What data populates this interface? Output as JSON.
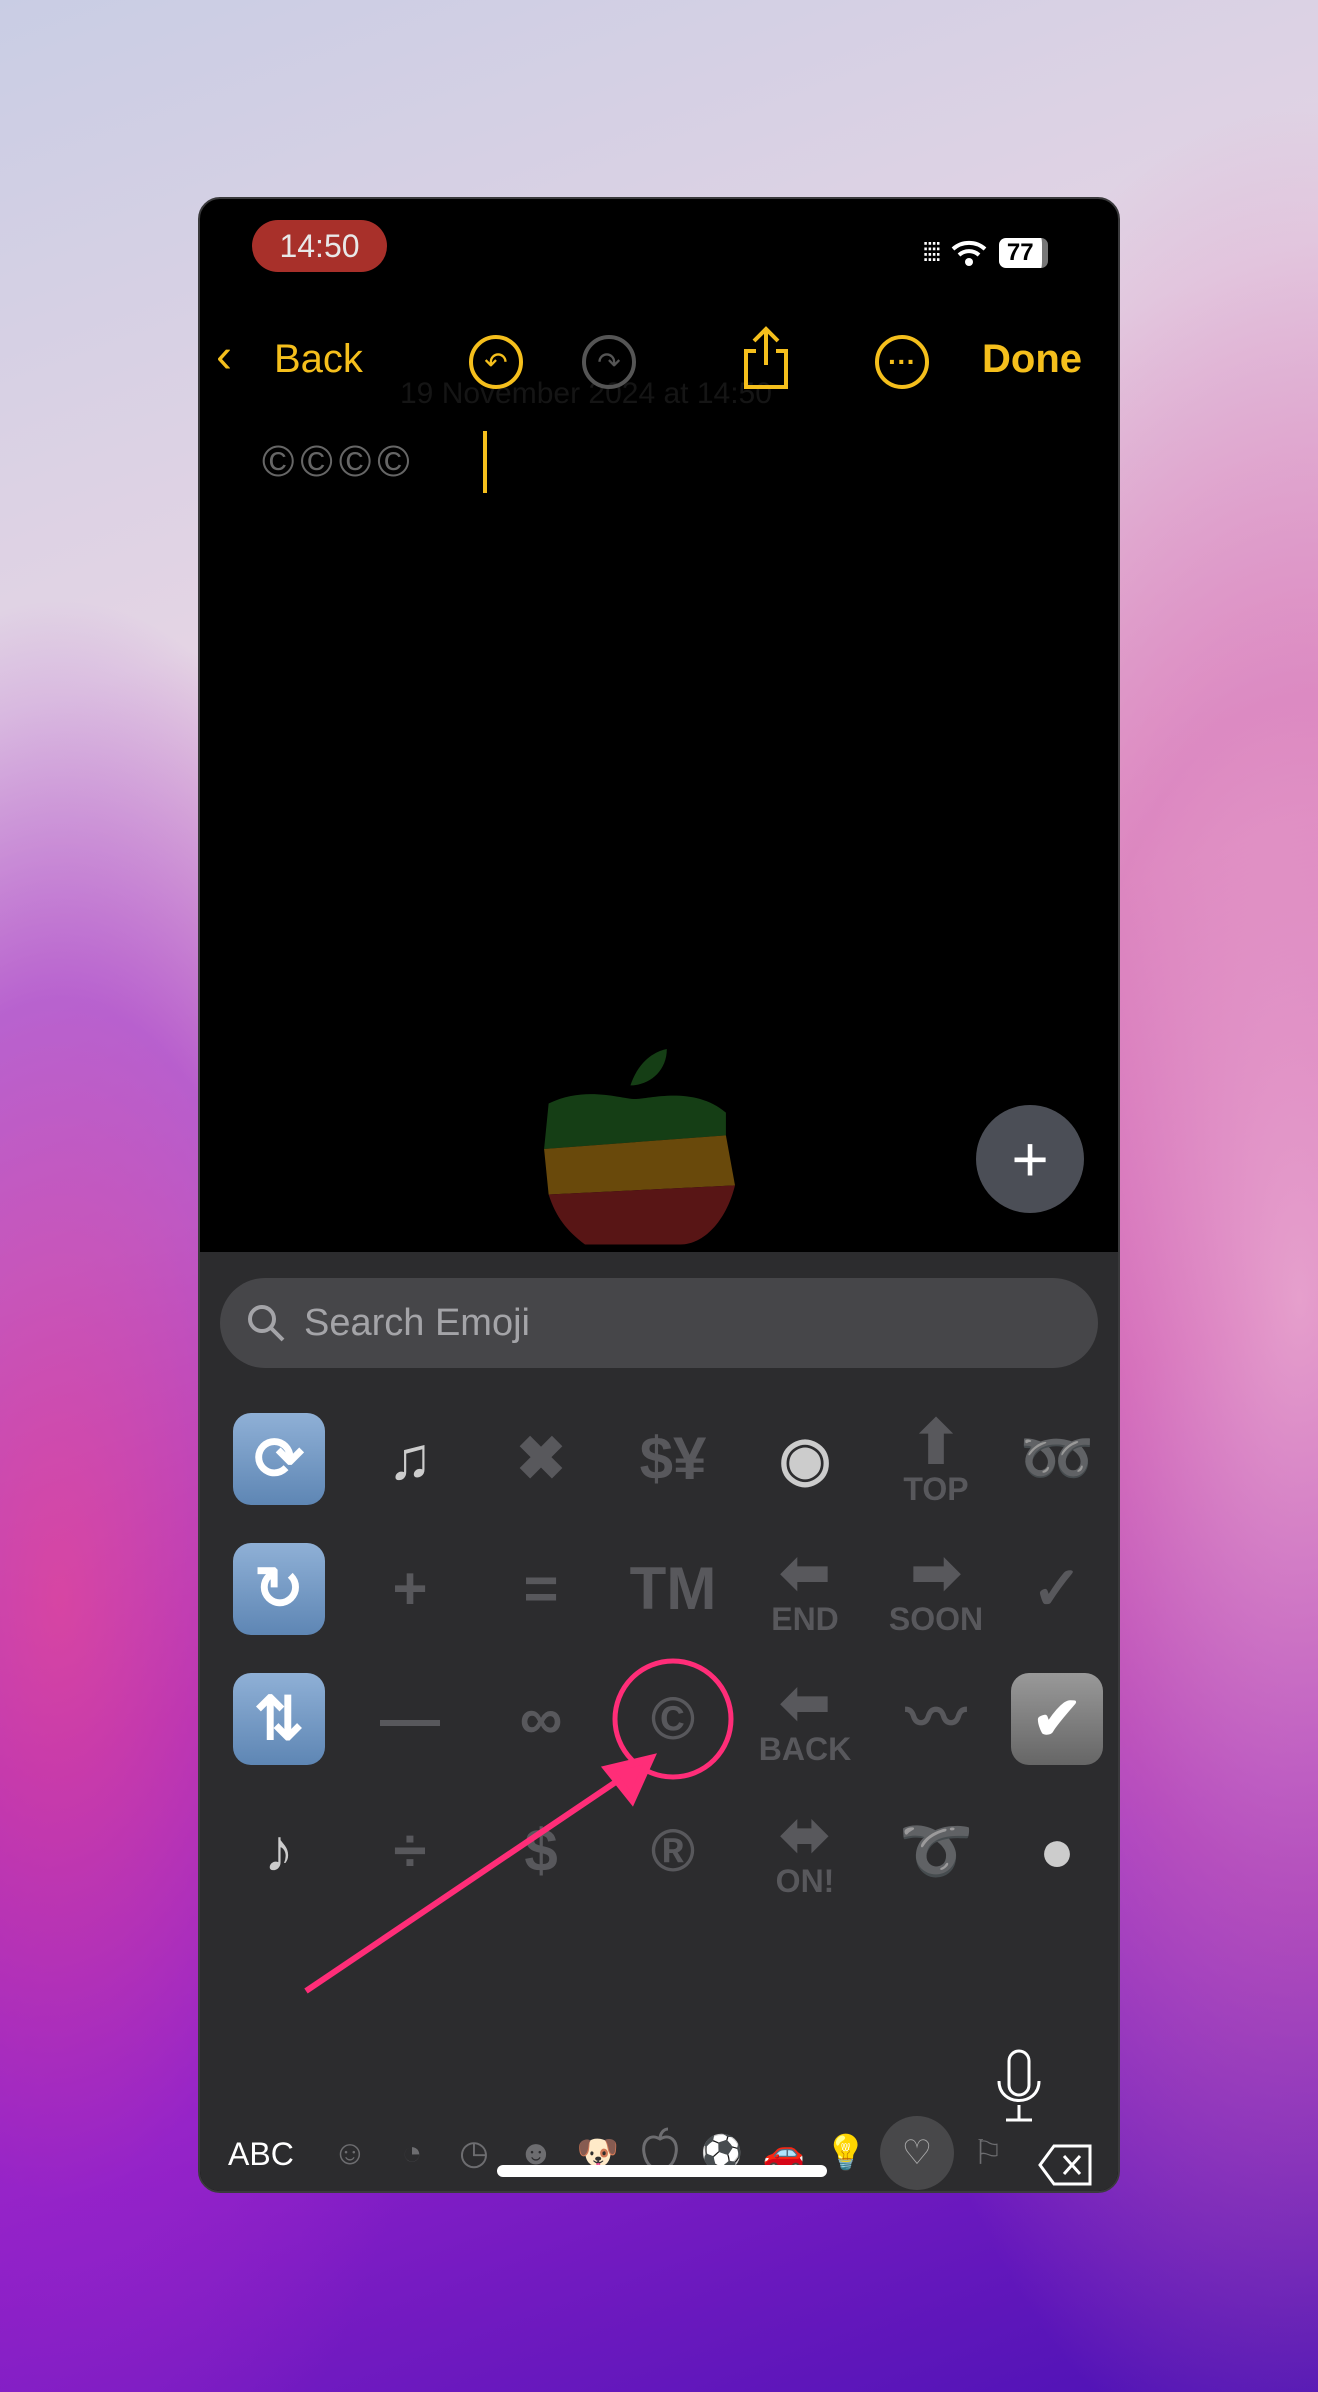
{
  "status": {
    "time": "14:50",
    "battery": "77",
    "time_pill_color": "#a8302a"
  },
  "nav": {
    "back": "Back",
    "done": "Done",
    "accent": "#f5bf1c",
    "icons": [
      "chevron-left",
      "undo",
      "redo",
      "share",
      "more"
    ]
  },
  "note": {
    "date": "19 November 2024 at 14:50",
    "content": "©©©©"
  },
  "fab": {
    "label": "+"
  },
  "keyboard": {
    "search_placeholder": "Search Emoji",
    "emoji_rows": [
      [
        {
          "g": "🔂",
          "t": "tile",
          "s": "⟳"
        },
        {
          "g": "🎶",
          "s": "♫"
        },
        {
          "g": "✖",
          "s": "✖"
        },
        {
          "g": "💱",
          "s": "$¥"
        },
        {
          "g": "👁‍🗨",
          "s": "◉"
        },
        {
          "g": "🔝",
          "s": "⬆",
          "l": "TOP"
        },
        {
          "g": "➿",
          "s": "➿"
        }
      ],
      [
        {
          "g": "🔄",
          "t": "tile",
          "s": "↻"
        },
        {
          "g": "➕",
          "s": "+"
        },
        {
          "g": "🟰",
          "s": "="
        },
        {
          "g": "™",
          "s": "TM"
        },
        {
          "g": "🔚",
          "s": "⬅",
          "l": "END"
        },
        {
          "g": "🔜",
          "s": "➡",
          "l": "SOON"
        },
        {
          "g": "✔",
          "s": "✓"
        }
      ],
      [
        {
          "g": "🔃",
          "t": "tile",
          "s": "⇅"
        },
        {
          "g": "➖",
          "s": "—"
        },
        {
          "g": "♾",
          "s": "∞"
        },
        {
          "g": "©",
          "s": "©"
        },
        {
          "g": "🔙",
          "s": "⬅",
          "l": "BACK"
        },
        {
          "g": "〰",
          "s": "〰"
        },
        {
          "g": "☑",
          "t": "graytile",
          "s": "✔"
        }
      ],
      [
        {
          "g": "🎵",
          "s": "♪"
        },
        {
          "g": "➗",
          "s": "÷"
        },
        {
          "g": "💲",
          "s": "$"
        },
        {
          "g": "®",
          "s": "®"
        },
        {
          "g": "🔛",
          "s": "⬌",
          "l": "ON!"
        },
        {
          "g": "➰",
          "s": "➰"
        },
        {
          "g": "🔘",
          "s": "●"
        }
      ]
    ],
    "abc": "ABC",
    "categories": [
      "☺",
      "◔",
      "◷",
      "☻",
      "🐶",
      "",
      "⚽",
      "🚗",
      "💡",
      "♡",
      "⚐"
    ],
    "selected_category": "symbols",
    "annotation_color": "#ff2d78"
  }
}
